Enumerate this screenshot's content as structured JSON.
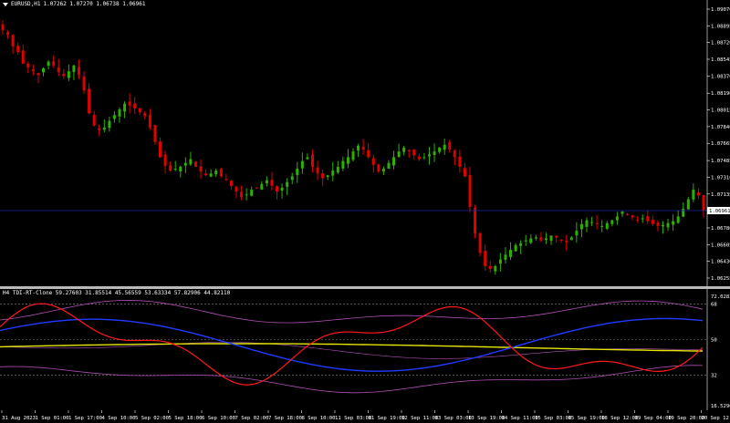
{
  "header": {
    "symbol_tf": "EURUSD,H1",
    "ohlc": "1.07262 1.07270 1.06738 1.06961"
  },
  "price_axis": {
    "ticks": [
      "1.09070",
      "1.08895",
      "1.08720",
      "1.08545",
      "1.08370",
      "1.08190",
      "1.08015",
      "1.07840",
      "1.07665",
      "1.07485",
      "1.07310",
      "1.07135",
      "1.06780",
      "1.06605",
      "1.06430",
      "1.06255"
    ],
    "current_price": "1.06961"
  },
  "indicator": {
    "title": "H4 TDI-RT-Clone 59.27603 31.85514 45.56559 53.63334 57.82906 44.82110",
    "axis_ticks": [
      "72.02827",
      "68",
      "50",
      "32",
      "16.5296"
    ]
  },
  "time_axis": {
    "labels": [
      "31 Aug 2023",
      "1 Sep 01:00",
      "1 Sep 17:00",
      "4 Sep 10:00",
      "5 Sep 02:00",
      "5 Sep 18:00",
      "6 Sep 10:00",
      "7 Sep 02:00",
      "7 Sep 18:00",
      "8 Sep 10:00",
      "11 Sep 03:00",
      "11 Sep 19:00",
      "12 Sep 11:00",
      "13 Sep 03:00",
      "13 Sep 19:00",
      "14 Sep 11:00",
      "15 Sep 03:00",
      "15 Sep 19:00",
      "18 Sep 12:00",
      "19 Sep 04:00",
      "19 Sep 20:00",
      "20 Sep 12:00"
    ]
  },
  "colors": {
    "background": "#000000",
    "bull": "#2db000",
    "bear": "#e00000",
    "price_line": "#1a24a8",
    "red_line": "#ff1a1a",
    "blue_line": "#1f3bff",
    "yellow_line": "#e6e600",
    "band": "#b04fb4"
  },
  "chart_data": {
    "type": "line",
    "title": "EURUSD,H1",
    "series": [
      {
        "name": "close",
        "values": [
          1.0885,
          1.088,
          1.0868,
          1.0862,
          1.085,
          1.0846,
          1.0842,
          1.0838,
          1.0845,
          1.0852,
          1.0848,
          1.0841,
          1.0837,
          1.0842,
          1.0848,
          1.0838,
          1.0822,
          1.0798,
          1.0785,
          1.078,
          1.0783,
          1.079,
          1.0796,
          1.0802,
          1.0808,
          1.0806,
          1.0803,
          1.0799,
          1.0795,
          1.0783,
          1.0768,
          1.0752,
          1.0743,
          1.0738,
          1.074,
          1.0742,
          1.0746,
          1.075,
          1.0742,
          1.0737,
          1.0733,
          1.0735,
          1.0738,
          1.0732,
          1.0728,
          1.0722,
          1.0716,
          1.071,
          1.0713,
          1.0718,
          1.072,
          1.0724,
          1.0728,
          1.0722,
          1.0716,
          1.072,
          1.0726,
          1.0732,
          1.074,
          1.0748,
          1.0752,
          1.0742,
          1.0735,
          1.073,
          1.0733,
          1.0738,
          1.0742,
          1.0748,
          1.0752,
          1.0758,
          1.0764,
          1.076,
          1.0752,
          1.0744,
          1.0737,
          1.074,
          1.0746,
          1.0752,
          1.0758,
          1.0762,
          1.0758,
          1.0754,
          1.075,
          1.0752,
          1.0755,
          1.0758,
          1.0762,
          1.0765,
          1.076,
          1.0752,
          1.0742,
          1.0732,
          1.07,
          1.0672,
          1.0652,
          1.0638,
          1.0635,
          1.0638,
          1.0645,
          1.065,
          1.0655,
          1.066,
          1.0662,
          1.0665,
          1.0667,
          1.0668,
          1.0665,
          1.0667,
          1.067,
          1.0668,
          1.0665,
          1.0663,
          1.0668,
          1.0675,
          1.0682,
          1.0686,
          1.0684,
          1.0682,
          1.068,
          1.0683,
          1.0686,
          1.069,
          1.0695,
          1.0692,
          1.0689,
          1.0686,
          1.0688,
          1.0685,
          1.0682,
          1.068,
          1.0681,
          1.0683,
          1.0685,
          1.069,
          1.0698,
          1.0708,
          1.0718,
          1.0712,
          1.0696
        ]
      }
    ]
  }
}
